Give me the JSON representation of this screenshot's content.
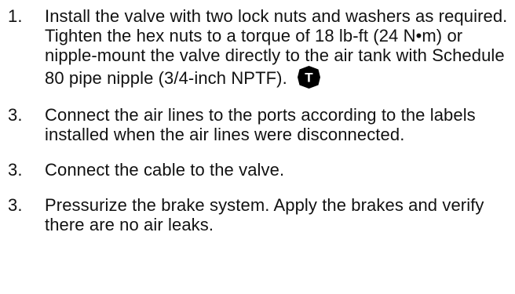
{
  "steps": [
    {
      "number": "1.",
      "text": "Install the valve with two lock nuts and washers as required. Tighten the hex nuts to a torque of 18 lb-ft (24 N•m) or nipple-mount the valve directly to the air tank with Schedule 80 pipe nipple (3/4-inch NPTF).",
      "icon": "torque-icon",
      "icon_label": "T"
    },
    {
      "number": "3.",
      "text": "Connect the air lines to the ports according to the labels installed when the air lines were disconnected."
    },
    {
      "number": "3.",
      "text": "Connect the cable to the valve."
    },
    {
      "number": "3.",
      "text": "Pressurize the brake system. Apply the brakes and verify there are no air leaks."
    }
  ],
  "colors": {
    "text": "#111111",
    "icon": "#000000",
    "icon_text": "#ffffff",
    "background": "#ffffff"
  }
}
